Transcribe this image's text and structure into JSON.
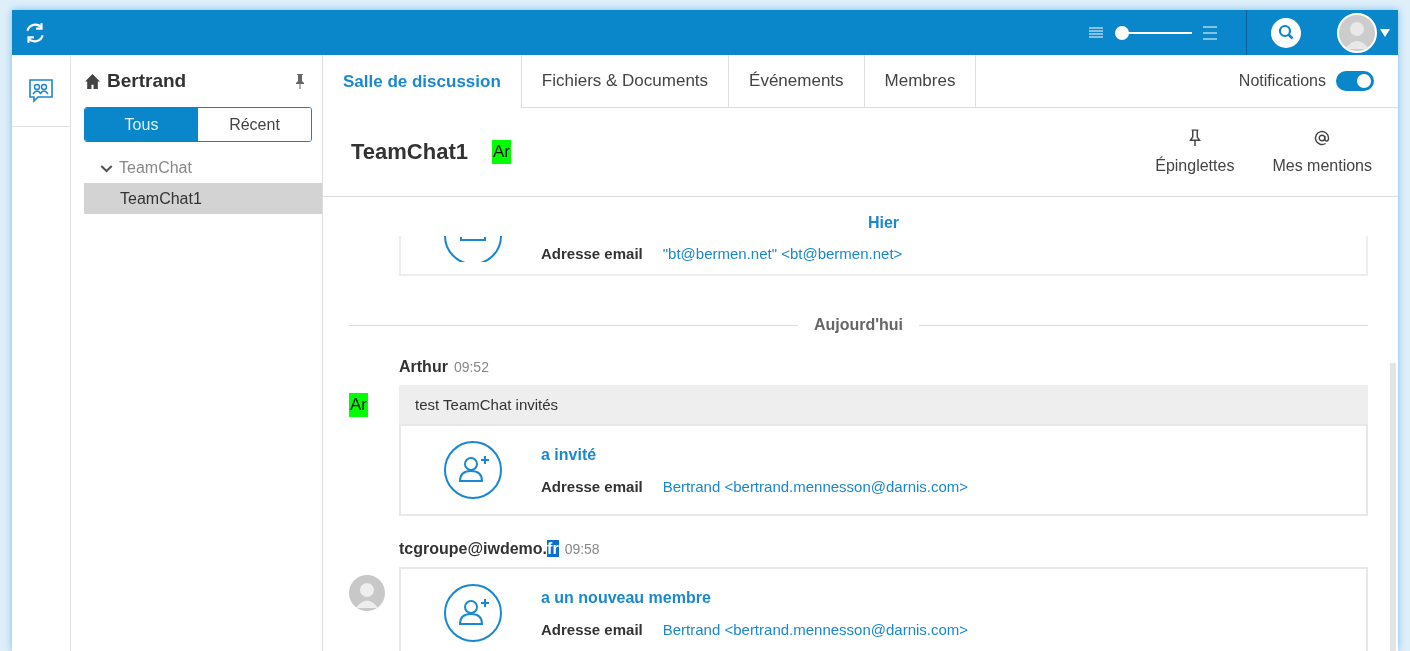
{
  "topbar": {
    "density_slider": {
      "level": 0.05
    }
  },
  "sidebar": {
    "title": "Bertrand",
    "filters": [
      {
        "label": "Tous",
        "selected": true
      },
      {
        "label": "Récent",
        "selected": false
      }
    ],
    "tree": [
      {
        "label": "TeamChat",
        "expanded": true,
        "selected": false,
        "children": [
          {
            "label": "TeamChat1",
            "selected": true
          }
        ]
      }
    ]
  },
  "tabs": [
    {
      "label": "Salle de discussion",
      "selected": true
    },
    {
      "label": "Fichiers & Documents",
      "selected": false
    },
    {
      "label": "Événements",
      "selected": false
    },
    {
      "label": "Membres",
      "selected": false
    }
  ],
  "notifications": {
    "label": "Notifications",
    "on": true
  },
  "room": {
    "title": "TeamChat1",
    "avatar": {
      "initials": "Ar",
      "color": "#00ff00"
    },
    "actions": [
      {
        "kind": "pin",
        "label": "Épinglettes"
      },
      {
        "kind": "mention",
        "label": "Mes mentions"
      }
    ]
  },
  "messages": [
    {
      "kind": "date-label",
      "label": "Hier"
    },
    {
      "kind": "partial-event",
      "email_label": "Adresse email",
      "email": "\"bt@bermen.net\" <bt@bermen.net>"
    },
    {
      "kind": "date-separator",
      "label": "Aujourd'hui"
    },
    {
      "kind": "message",
      "author": "Arthur",
      "time": "09:52",
      "avatar": {
        "kind": "initials",
        "initials": "Ar",
        "color": "#00ff00"
      },
      "text": "test TeamChat invités",
      "event": {
        "title": "a invité",
        "email_label": "Adresse email",
        "email": "Bertrand <bertrand.mennesson@darnis.com>"
      }
    },
    {
      "kind": "message",
      "author": "tcgroupe@iwdemo.",
      "author_selected_part": "fr",
      "time": "09:58",
      "avatar": {
        "kind": "photo"
      },
      "event": {
        "title": "a un nouveau membre",
        "email_label": "Adresse email",
        "email": "Bertrand <bertrand.mennesson@darnis.com>"
      }
    }
  ]
}
